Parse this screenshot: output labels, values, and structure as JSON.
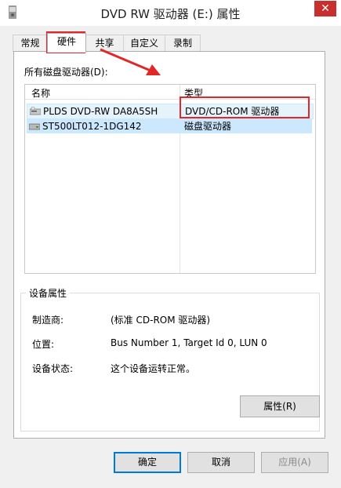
{
  "window": {
    "title": "DVD RW 驱动器 (E:) 属性",
    "close_glyph": "✕"
  },
  "tabs": [
    {
      "label": "常规"
    },
    {
      "label": "硬件"
    },
    {
      "label": "共享"
    },
    {
      "label": "自定义"
    },
    {
      "label": "录制"
    }
  ],
  "hardware": {
    "drives_label": "所有磁盘驱动器(D):",
    "columns": {
      "name": "名称",
      "type": "类型"
    },
    "rows": [
      {
        "name": "PLDS DVD-RW DA8A5SH",
        "type": "DVD/CD-ROM 驱动器",
        "icon": "dvd-drive-icon"
      },
      {
        "name": "ST500LT012-1DG142",
        "type": "磁盘驱动器",
        "icon": "hard-disk-icon"
      }
    ],
    "device_props": {
      "title": "设备属性",
      "manufacturer_label": "制造商:",
      "manufacturer_value": "(标准 CD-ROM 驱动器)",
      "location_label": "位置:",
      "location_value": "Bus Number 1, Target Id 0, LUN 0",
      "status_label": "设备状态:",
      "status_value": "这个设备运转正常。",
      "properties_button": "属性(R)"
    }
  },
  "footer": {
    "ok": "确定",
    "cancel": "取消",
    "apply": "应用(A)"
  },
  "colors": {
    "annotation_red": "#e0282b",
    "selection_blue": "#cce8ff",
    "close_red": "#c7302c"
  }
}
